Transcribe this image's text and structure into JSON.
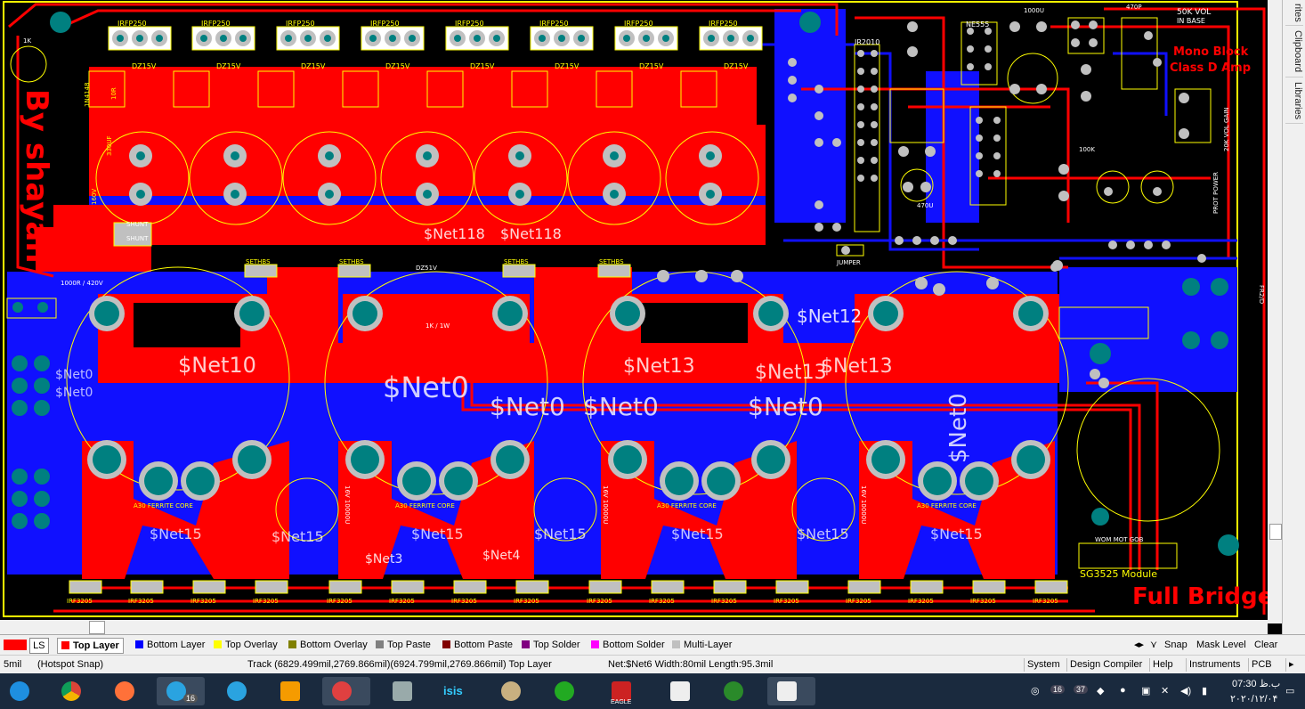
{
  "board": {
    "author_text": "By shayan",
    "title_text": "Full Bridge",
    "module_text": "SG3525 Module",
    "mono_block_text": "Mono Block",
    "class_d_text": "Class D Amp",
    "labels": {
      "irfp250": "IRFP250",
      "dz15v": "DZ15V",
      "diode_1n4148": "1N4148",
      "r10": "10R",
      "cap_330uf": "330UF",
      "cap_160v": "160V",
      "shunt": "SHUNT",
      "res_1000r": "1000R / 420V",
      "net118": "$Net118",
      "net0": "$Net0",
      "net10": "$Net10",
      "net12": "$Net12",
      "net13": "$Net13",
      "net15": "$Net15",
      "net3": "$Net3",
      "net4": "$Net4",
      "irf3205": "IRF3205",
      "ferrite_core": "A30 FERRITE CORE",
      "ir2010": "IR2010",
      "ne555": "NE555",
      "jumper": "JUMPER",
      "sethbs": "SETHBS",
      "dz51v": "DZ51V",
      "r1k": "1K / 1W",
      "pot": "50K VOL",
      "in_bass": "IN BASE",
      "vol_gain": "20K VOL GAIN",
      "prot_power": "PROT POWER",
      "cap_1000u": "1000U",
      "cap_470u": "470U",
      "cap_10000u": "16V 10000U",
      "res_100k": "100K",
      "c470p": "470P",
      "c1k": "1K",
      "hex": "FR2/D",
      "wo_bottom": "WOM MOT GOB"
    }
  },
  "right_panel": {
    "tabs": [
      "rites",
      "Clipboard",
      "Libraries"
    ]
  },
  "layers": {
    "ls_label": "LS",
    "items": [
      {
        "label": "Top Layer",
        "color": "#ff0000",
        "active": true
      },
      {
        "label": "Bottom Layer",
        "color": "#0000ff",
        "active": false
      },
      {
        "label": "Top Overlay",
        "color": "#ffff00",
        "active": false
      },
      {
        "label": "Bottom Overlay",
        "color": "#808000",
        "active": false
      },
      {
        "label": "Top Paste",
        "color": "#808080",
        "active": false
      },
      {
        "label": "Bottom Paste",
        "color": "#800000",
        "active": false
      },
      {
        "label": "Top Solder",
        "color": "#800080",
        "active": false
      },
      {
        "label": "Bottom Solder",
        "color": "#ff00ff",
        "active": false
      },
      {
        "label": "Multi-Layer",
        "color": "#c0c0c0",
        "active": false
      }
    ],
    "snap": "Snap",
    "mask_level": "Mask Level",
    "clear": "Clear"
  },
  "status": {
    "grid": "5mil",
    "hotspot": "(Hotspot Snap)",
    "track": "Track (6829.499mil,2769.866mil)(6924.799mil,2769.866mil)  Top Layer",
    "net": "Net:$Net6 Width:80mil Length:95.3mil",
    "buttons": [
      "System",
      "Design Compiler",
      "Help",
      "Instruments",
      "PCB"
    ]
  },
  "taskbar": {
    "apps": [
      "internet-explorer",
      "chrome",
      "firefox",
      "telegram-desktop",
      "telegram",
      "media-player",
      "snipping-tool",
      "calculator",
      "isis",
      "paint",
      "app-green",
      "eagle",
      "scanner",
      "browser-globe",
      "scanner-2"
    ],
    "telegram_badge": "16",
    "eagle_label": "EAGLE",
    "isis_label": "isis",
    "time": "07:30 ب.ظ",
    "date": "۲۰۲۰/۱۲/۰۴",
    "tray_badges": [
      "16",
      "37"
    ]
  },
  "colors": {
    "top_layer": "#ff0000",
    "bottom_layer": "#1010ff",
    "overlay": "#ffff00",
    "pad": "#c0c0c0",
    "via_hole": "#008080",
    "board_bg": "#000000"
  }
}
